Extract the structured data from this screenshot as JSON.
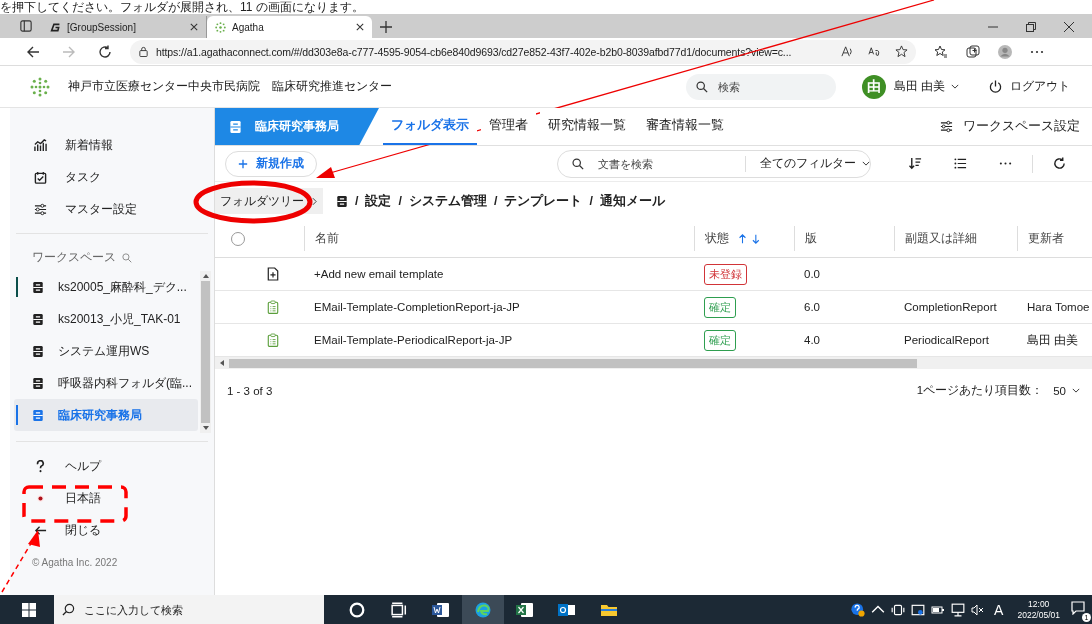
{
  "caption": "を押下してください。フォルダが展開され、11 の画面になります。",
  "browser": {
    "tabs": [
      {
        "title": "[GroupSession]",
        "selected": false,
        "kind": "groupsession"
      },
      {
        "title": "Agatha",
        "selected": true,
        "kind": "agatha"
      }
    ],
    "url": "https://a1.agathaconnect.com/#/dd303e8a-c777-4595-9054-cb6e840d9693/cd27e852-43f7-402e-b2b0-8039afbd77d1/documents?view=c..."
  },
  "header": {
    "organization": "神戸市立医療センター中央市民病院",
    "department": "臨床研究推進センター",
    "search_placeholder": "検索",
    "avatar": "由",
    "user": "島田 由美",
    "logout": "ログアウト"
  },
  "sidebar": {
    "nav": [
      {
        "label": "新着情報",
        "kind": "news"
      },
      {
        "label": "タスク",
        "kind": "task"
      },
      {
        "label": "マスター設定",
        "kind": "settings"
      }
    ],
    "workspace_heading": "ワークスペース",
    "workspaces": [
      {
        "label": "ks20005_麻酔科_デク...",
        "selected": false,
        "pinned": true
      },
      {
        "label": "ks20013_小児_TAK-01",
        "selected": false,
        "pinned": false
      },
      {
        "label": "システム運用WS",
        "selected": false,
        "pinned": false
      },
      {
        "label": "呼吸器内科フォルダ(臨...",
        "selected": false,
        "pinned": false
      },
      {
        "label": "臨床研究事務局",
        "selected": true,
        "pinned": false
      }
    ],
    "footer_items": [
      {
        "label": "ヘルプ",
        "kind": "help"
      },
      {
        "label": "日本語",
        "kind": "language"
      },
      {
        "label": "閉じる",
        "kind": "close"
      }
    ],
    "copyright": "© Agatha Inc. 2022"
  },
  "workspace_tab": "臨床研究事務局",
  "tabs": [
    {
      "label": "フォルダ表示",
      "selected": true
    },
    {
      "label": "管理者",
      "selected": false
    },
    {
      "label": "研究情報一覧",
      "selected": false
    },
    {
      "label": "審査情報一覧",
      "selected": false
    }
  ],
  "workspace_settings": "ワークスペース設定",
  "toolbar": {
    "new_button": "新規作成",
    "search_placeholder": "文書を検索",
    "filter": "全てのフィルター"
  },
  "breadcrumb": {
    "tree_button": "フォルダツリー",
    "separator": "/",
    "path": [
      "設定",
      "システム管理",
      "テンプレート",
      "通知メール"
    ]
  },
  "table": {
    "select_all": false,
    "columns": [
      {
        "label": "名前",
        "sort_arrows": false
      },
      {
        "label": "状態",
        "sort_arrows": true
      },
      {
        "label": "版",
        "sort_arrows": false
      },
      {
        "label": "副題又は詳細",
        "sort_arrows": false
      },
      {
        "label": "更新者",
        "sort_arrows": false
      }
    ],
    "rows": [
      {
        "kind": "add",
        "name": "+Add new email template",
        "status": "未登録",
        "color": "#d13438",
        "version": "0.0",
        "detail": "",
        "updater": ""
      },
      {
        "kind": "document",
        "name": "EMail-Template-CompletionReport-ja-JP",
        "status": "確定",
        "color": "#2e9e4f",
        "version": "6.0",
        "detail": "CompletionReport",
        "updater": "Hara Tomoe"
      },
      {
        "kind": "document",
        "name": "EMail-Template-PeriodicalReport-ja-JP",
        "status": "確定",
        "color": "#2e9e4f",
        "version": "4.0",
        "detail": "PeriodicalReport",
        "updater": "島田 由美"
      }
    ]
  },
  "footer": {
    "range": "1 - 3 of 3",
    "per_page_label": "1ページあたり項目数：",
    "per_page": "50"
  },
  "taskbar": {
    "search_placeholder": "ここに入力して検索",
    "ime": "A",
    "time": "12:00",
    "date": "2022/05/01",
    "notification_count": "1"
  }
}
